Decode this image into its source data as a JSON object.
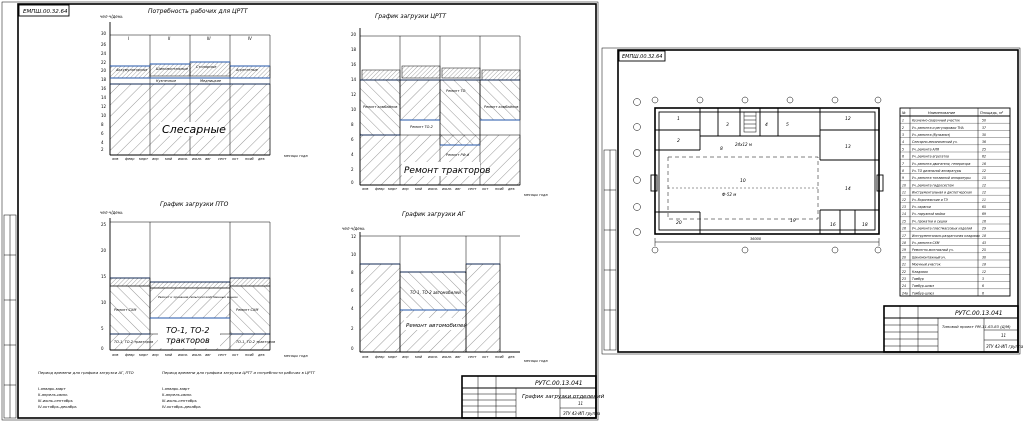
{
  "sheet1": {
    "stamp": "ЕМПШ.00.32.64",
    "cpt_needs": {
      "title": "Потребность рабочих для ЦРТТ",
      "y_label": "чел-ч/день",
      "y_ticks": [
        "30",
        "26",
        "24",
        "22",
        "20",
        "18",
        "16",
        "14",
        "12",
        "10",
        "8",
        "6",
        "4",
        "2",
        "0"
      ],
      "quarters": [
        "I",
        "II",
        "III",
        "IV"
      ],
      "months": [
        "янв",
        "февр",
        "март",
        "апр",
        "май",
        "июнь",
        "июль",
        "авг",
        "сент",
        "окт",
        "нояб",
        "дек"
      ],
      "x_label": "месяцы года",
      "bands": [
        "Аккумуляторные",
        "Шиномонтажные",
        "Столярные",
        "Агрегатные",
        "Кузнечные",
        "Медницкие"
      ],
      "big_label": "Слесарные"
    },
    "cpt_load": {
      "title": "График загрузки ЦРТТ",
      "y_ticks": [
        "20",
        "18",
        "16",
        "14",
        "12",
        "10",
        "8",
        "6",
        "4",
        "2",
        "0"
      ],
      "labels": [
        "Ремонт комбайнов",
        "Ремонт ТО-2",
        "Ремонт ТО",
        "Ремонт РФ-й",
        "Ремонт комбайнов"
      ],
      "big_label": "Ремонт тракторов",
      "x_label": "месяцы года"
    },
    "to_load": {
      "title": "График загрузки ПТО",
      "y_label": "чел-ч/день",
      "y_ticks": [
        "25",
        "20",
        "15",
        "10",
        "5",
        "0"
      ],
      "left_label": "Ремонт СХМ",
      "mid_note": "Ремонт и хранение сельскохозяйственных машин",
      "right_label": "Ремонт СХМ",
      "bottom_left": "ТО-1, ТО-2 тракторов",
      "big_label": "ТО-1, ТО-2 тракторов",
      "bottom_right": "ТО-1, ТО-2 тракторов",
      "x_label": "месяцы года"
    },
    "ag_load": {
      "title": "График загрузки АГ",
      "y_label": "чел-ч/день",
      "y_ticks": [
        "12",
        "10",
        "8",
        "6",
        "4",
        "2",
        "0"
      ],
      "upper_label": "ТО-1, ТО-2 автомобилей",
      "lower_label": "Ремонт автомобилей",
      "x_label": "месяцы года"
    },
    "notes": [
      {
        "heading": "Период времени для графика загрузки АГ, ПТО",
        "lines": [
          "I-январь-март",
          "II-апрель-июнь",
          "III-июль-сентябрь",
          "IV-октябрь-декабрь"
        ]
      },
      {
        "heading": "Период времени для графика загрузки ЦРТТ и потребности рабочих в ЦРТТ",
        "lines": [
          "I-январь-март",
          "II-апрель-июнь",
          "III-июль-сентябрь",
          "IV-октябрь-декабрь"
        ]
      }
    ],
    "titleblock": {
      "doc": "РУТС.00.13.041",
      "name": "График загрузки отделений",
      "sheet": "11",
      "group": "ЗТУ 43-ИП группа"
    }
  },
  "sheet2": {
    "stamp": "ЕМПШ.00.32.64",
    "dims": {
      "span": "24x12 м",
      "a": "Ф-52 м",
      "b": "20",
      "c": "36000"
    },
    "table_headers": [
      "№",
      "Наименование",
      "Площадь, м²"
    ],
    "rows": [
      [
        "1",
        "Кузнечно-сварочный участок",
        "50"
      ],
      [
        "2",
        "Уч. ремонта и регулировки ТНА",
        "37"
      ],
      [
        "3",
        "Уч. ремонта (Вулканиз)",
        "30"
      ],
      [
        "4",
        "Слесарно-механический уч.",
        "36"
      ],
      [
        "5",
        "Уч. ремонта АЛЯ",
        "25"
      ],
      [
        "6",
        "Уч. ремонта агрегатов",
        "62"
      ],
      [
        "7",
        "Уч. ремонта двигателя, генератора",
        "16"
      ],
      [
        "8",
        "Уч. ТО дизельной аппаратуры",
        "12"
      ],
      [
        "9",
        "Уч. ремонта топливной аппаратуры",
        "15"
      ],
      [
        "10",
        "Уч. ремонта гидросистем",
        "12"
      ],
      [
        "11",
        "Инструментальная и диспетчерская",
        "12"
      ],
      [
        "12",
        "Уч. Воронежские и ТЭ",
        "11"
      ],
      [
        "13",
        "Уч. окраски",
        "65"
      ],
      [
        "14",
        "Уч. наружной мойки",
        "69"
      ],
      [
        "15",
        "Уч. прокатки и сушки",
        "16"
      ],
      [
        "16",
        "Уч. ремонта пластмассовых изделий",
        "29"
      ],
      [
        "17",
        "Инструментально-раздаточная кладовая",
        "18"
      ],
      [
        "18",
        "Уч. ремонта СХМ",
        "43"
      ],
      [
        "19",
        "Ремонтно-монтажный уч.",
        "25"
      ],
      [
        "20",
        "Шиномонтажный уч.",
        "30"
      ],
      [
        "21",
        "Моечный участок",
        "18"
      ],
      [
        "22",
        "Кладовая",
        "12"
      ],
      [
        "23",
        "Тамбур",
        "3"
      ],
      [
        "24",
        "Тамбур-шлюз",
        "6"
      ],
      [
        "24a",
        "Тамбур-шлюз",
        "6"
      ]
    ],
    "titleblock": {
      "doc": "РУТС.00.13.041",
      "name": "Типовой проект РМ-11.63.83 (Д/М)",
      "sheet": "11",
      "group": "ЗТУ 43-ИП группа"
    }
  },
  "colors": {
    "line": "#000000",
    "accent": "#2255aa",
    "paper": "#ffffff"
  }
}
